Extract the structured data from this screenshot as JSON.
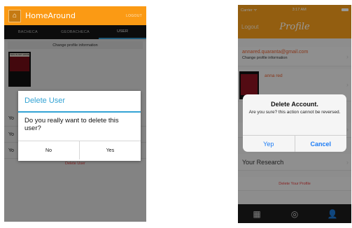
{
  "android": {
    "app_name": "HomeAround",
    "logout_label": "LOGOUT",
    "tabs": [
      {
        "label": "BACHECA"
      },
      {
        "label": "GEOBACHECA"
      },
      {
        "label": "USER"
      }
    ],
    "change_profile": "Change profile information",
    "avatar_title": "THIS IS NOT HOME",
    "rows": [
      {
        "label": "Yo"
      },
      {
        "label": "Yo"
      },
      {
        "label": "Yo"
      }
    ],
    "delete_user_link": "Delete User",
    "dialog": {
      "title": "Delete User",
      "message": "Do you really want to delete this user?",
      "no_label": "No",
      "yes_label": "Yes"
    },
    "colors": {
      "actionbar": "#fb9a14",
      "tabs_bg": "#161616",
      "dialog_accent": "#33a3d4",
      "delete": "#e03b3b"
    }
  },
  "ios": {
    "status": {
      "carrier": "Carrier ᯤ",
      "time": "3:17 AM",
      "battery": "battery-icon"
    },
    "logout_label": "Logout",
    "title": "Profile",
    "email": "annared.quaranta@gmail.com",
    "change_profile": "Change profile information",
    "name": "anna red",
    "research_label": "Your Research",
    "delete_profile_link": "Delete Your Profile",
    "alert": {
      "title": "Delete Account.",
      "message": "Are you sure? this action cannot be reversed.",
      "yes_label": "Yep",
      "cancel_label": "Cancel"
    },
    "tabbar": [
      {
        "icon": "grid-icon"
      },
      {
        "icon": "target-icon"
      },
      {
        "icon": "user-icon"
      }
    ],
    "colors": {
      "header": "#f59d1c",
      "accent_text": "#e25a2a",
      "alert_button": "#1c7cf5"
    }
  }
}
